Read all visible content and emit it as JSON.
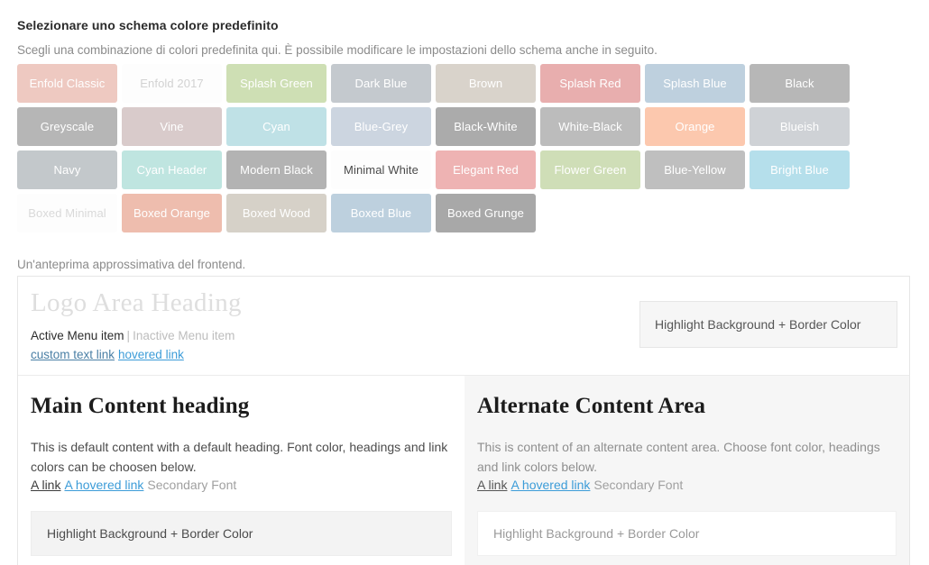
{
  "header": {
    "title": "Selezionare uno schema colore predefinito",
    "description": "Scegli una combinazione di colori predefinita qui. È possibile modificare le impostazioni dello schema anche in seguito."
  },
  "swatches": [
    {
      "label": "Enfold Classic",
      "bg": "#eec9c1",
      "fg": "#ffffff"
    },
    {
      "label": "Enfold 2017",
      "bg": "#fdfdfd",
      "fg": "#d2d2d2"
    },
    {
      "label": "Splash Green",
      "bg": "#cedfb4",
      "fg": "#ffffff"
    },
    {
      "label": "Dark Blue",
      "bg": "#c4c9ce",
      "fg": "#ffffff"
    },
    {
      "label": "Brown",
      "bg": "#d9d3cb",
      "fg": "#ffffff"
    },
    {
      "label": "Splash Red",
      "bg": "#e8aeae",
      "fg": "#ffffff"
    },
    {
      "label": "Splash Blue",
      "bg": "#bed0de",
      "fg": "#ffffff"
    },
    {
      "label": "Black",
      "bg": "#b7b7b7",
      "fg": "#ffffff"
    },
    {
      "label": "Greyscale",
      "bg": "#b6b6b6",
      "fg": "#ffffff"
    },
    {
      "label": "Vine",
      "bg": "#d9cbcb",
      "fg": "#ffffff"
    },
    {
      "label": "Cyan",
      "bg": "#bfe1e6",
      "fg": "#ffffff"
    },
    {
      "label": "Blue-Grey",
      "bg": "#ccd5e0",
      "fg": "#ffffff"
    },
    {
      "label": "Black-White",
      "bg": "#ababab",
      "fg": "#ffffff"
    },
    {
      "label": "White-Black",
      "bg": "#bcbcbc",
      "fg": "#ffffff"
    },
    {
      "label": "Orange",
      "bg": "#fcc8ae",
      "fg": "#ffffff"
    },
    {
      "label": "Blueish",
      "bg": "#cfd2d6",
      "fg": "#ffffff"
    },
    {
      "label": "Navy",
      "bg": "#c3c8cb",
      "fg": "#ffffff"
    },
    {
      "label": "Cyan Header",
      "bg": "#bfe5e0",
      "fg": "#ffffff"
    },
    {
      "label": "Modern Black",
      "bg": "#b3b3b3",
      "fg": "#ffffff"
    },
    {
      "label": "Minimal White",
      "bg": "#fdfdfd",
      "fg": "#4a4a4a"
    },
    {
      "label": "Elegant Red",
      "bg": "#eeb3b3",
      "fg": "#ffffff"
    },
    {
      "label": "Flower Green",
      "bg": "#cfdeb7",
      "fg": "#ffffff"
    },
    {
      "label": "Blue-Yellow",
      "bg": "#bfbfbf",
      "fg": "#ffffff"
    },
    {
      "label": "Bright Blue",
      "bg": "#b5dfeb",
      "fg": "#ffffff"
    },
    {
      "label": "Boxed Minimal",
      "bg": "#fdfdfd",
      "fg": "#d9d9d9"
    },
    {
      "label": "Boxed Orange",
      "bg": "#eebdae",
      "fg": "#ffffff"
    },
    {
      "label": "Boxed Wood",
      "bg": "#d6d1c8",
      "fg": "#ffffff"
    },
    {
      "label": "Boxed Blue",
      "bg": "#bdd0de",
      "fg": "#ffffff"
    },
    {
      "label": "Boxed Grunge",
      "bg": "#a8a8a8",
      "fg": "#ffffff"
    }
  ],
  "preview": {
    "note": "Un'anteprima approssimativa del frontend.",
    "logo_heading": "Logo Area Heading",
    "menu": {
      "active": "Active Menu item",
      "separator": "|",
      "inactive": "Inactive Menu item"
    },
    "links": {
      "custom": "custom text link",
      "hovered": "hovered link"
    },
    "header_highlight": "Highlight Background + Border Color",
    "main_column": {
      "heading": "Main Content heading",
      "paragraph": "This is default content with a default heading. Font color, headings and link colors can be choosen below.",
      "link": "A link",
      "hovered_link": "A hovered link",
      "secondary_font": "Secondary Font",
      "highlight": "Highlight Background + Border Color"
    },
    "alternate_column": {
      "heading": "Alternate Content Area",
      "paragraph": "This is content of an alternate content area. Choose font color, headings and link colors below.",
      "link": "A link",
      "hovered_link": "A hovered link",
      "secondary_font": "Secondary Font",
      "highlight": "Highlight Background + Border Color"
    }
  }
}
